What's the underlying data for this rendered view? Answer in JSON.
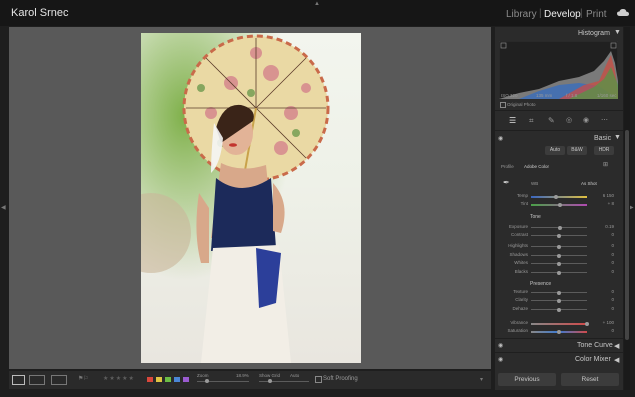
{
  "app": {
    "user": "Karol Srnec"
  },
  "modules": {
    "library": "Library",
    "sep1": "|",
    "develop": "Develop",
    "sep2": "|",
    "print": "Print"
  },
  "histogram": {
    "title": "Histogram",
    "info": [
      "ISO 320",
      "135 mm",
      "f / 1.8",
      "1/160 sec"
    ],
    "original_photo": "Original Photo"
  },
  "basic": {
    "title": "Basic",
    "buttons": {
      "auto": "Auto",
      "bw": "B&W",
      "hdr": "HDR"
    },
    "profile_label": "Profile",
    "profile_value": "Adobe Color",
    "wb_label": "WB",
    "wb_value": "As Shot",
    "temp": {
      "label": "Temp",
      "value": "6 150"
    },
    "tint": {
      "label": "Tint",
      "value": "+ 8"
    },
    "tone_title": "Tone",
    "exposure": {
      "label": "Exposure",
      "value": "0.19"
    },
    "contrast": {
      "label": "Contrast",
      "value": "0"
    },
    "highlights": {
      "label": "Highlights",
      "value": "0"
    },
    "shadows": {
      "label": "Shadows",
      "value": "0"
    },
    "whites": {
      "label": "Whites",
      "value": "0"
    },
    "blacks": {
      "label": "Blacks",
      "value": "0"
    },
    "presence_title": "Presence",
    "texture": {
      "label": "Texture",
      "value": "0"
    },
    "clarity": {
      "label": "Clarity",
      "value": "0"
    },
    "dehaze": {
      "label": "Dehaze",
      "value": "0"
    },
    "vibrance": {
      "label": "Vibrance",
      "value": "+ 100"
    },
    "saturation": {
      "label": "Saturation",
      "value": "0"
    }
  },
  "panels": {
    "tone_curve": "Tone Curve",
    "color_mixer": "Color Mixer"
  },
  "footer": {
    "previous": "Previous",
    "reset": "Reset"
  },
  "toolbar": {
    "zoom_label": "Zoom",
    "zoom_value": "18.9%",
    "show_grid": "Show Grid",
    "grid_value": "Auto",
    "soft_proofing": "Soft Proofing",
    "stars": "★★★★★",
    "label_colors": [
      "#d9473b",
      "#e0c443",
      "#6bbd45",
      "#4b86d6",
      "#9a5bd0"
    ]
  }
}
